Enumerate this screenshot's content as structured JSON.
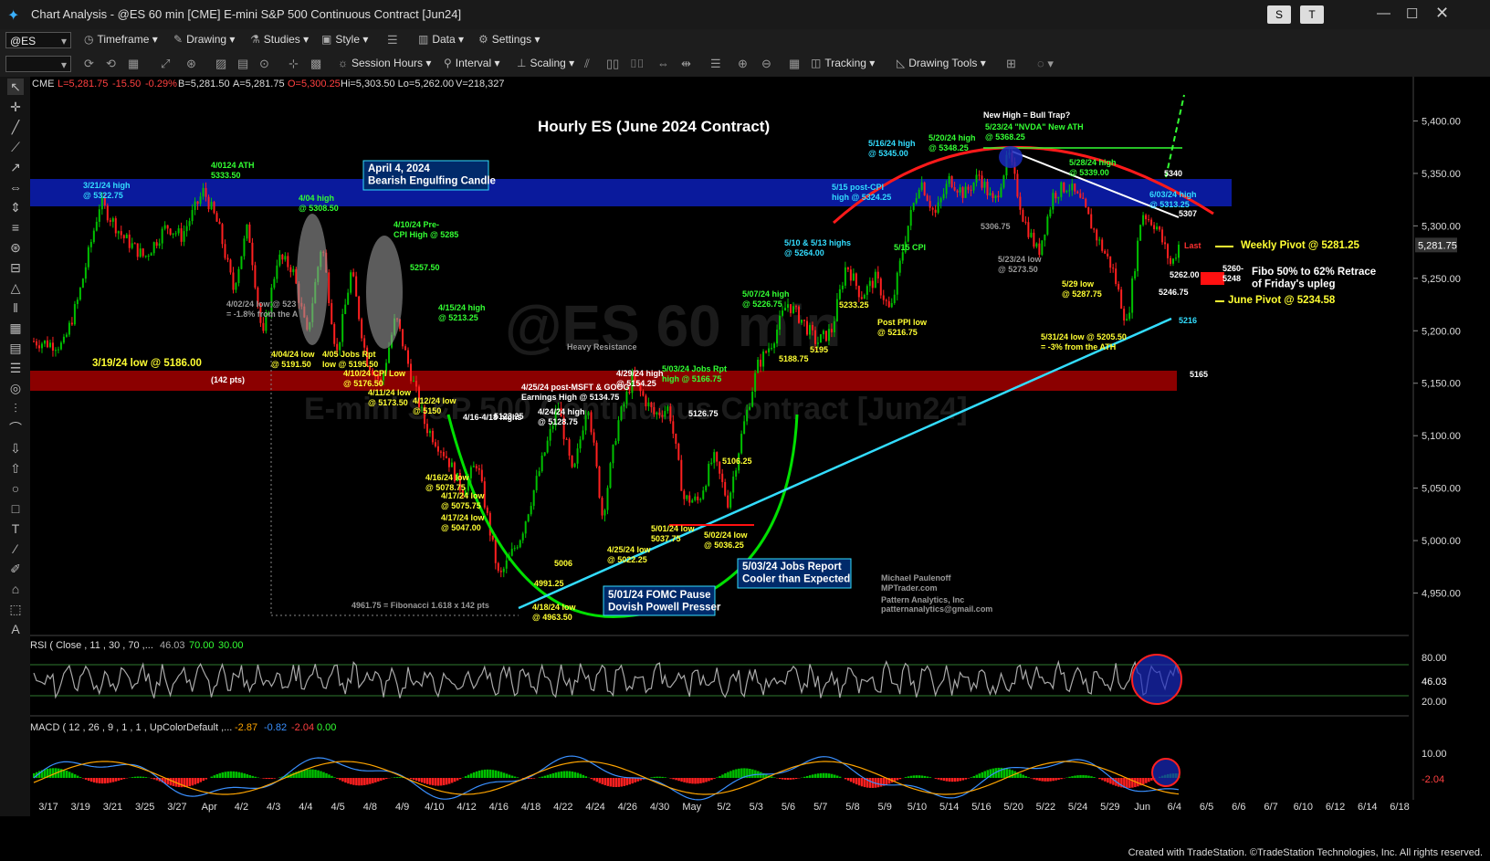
{
  "window": {
    "title": "Chart Analysis - @ES 60 min [CME] E-mini S&P 500 Continuous Contract [Jun24]",
    "btn_s": "S",
    "btn_t": "T"
  },
  "toolbar1": {
    "symbol": "@ES",
    "timeframe": "Timeframe",
    "drawing": "Drawing",
    "studies": "Studies",
    "style": "Style",
    "data": "Data",
    "settings": "Settings"
  },
  "toolbar2": {
    "session_hours": "Session Hours",
    "interval": "Interval",
    "scaling": "Scaling",
    "tracking": "Tracking",
    "drawing_tools": "Drawing Tools"
  },
  "chart_header": {
    "exchange": "CME",
    "last": "L=5,281.75",
    "change": "-15.50",
    "pct": "-0.29%",
    "bid": "B=5,281.50",
    "ask": "A=5,281.75",
    "open": "O=5,300.25",
    "hilo": "Hi=5,303.50  Lo=5,262.00",
    "volume": "V=218,327"
  },
  "colors": {
    "up": "#00c000",
    "down": "#ff2020",
    "band_blue": "#0a1a9c",
    "band_red": "#8b0000",
    "label_yellow": "#ffff33",
    "label_green": "#33ff33",
    "label_cyan": "#33ddff"
  },
  "chart_data": {
    "type": "candlestick",
    "title": "Hourly ES (June 2024 Contract)",
    "watermark_line1": "@ES 60 min",
    "watermark_line2": "E-mini S&P 500 Continuous Contract [Jun24]",
    "ylim": [
      4920,
      5430
    ],
    "y_ticks": [
      "5,400.00",
      "5,350.00",
      "5,300.00",
      "5,250.00",
      "5,200.00",
      "5,150.00",
      "5,100.00",
      "5,050.00",
      "5,000.00",
      "4,950.00"
    ],
    "last_price": "5,281.75",
    "x_ticks": [
      "3/17",
      "3/19",
      "3/21",
      "3/25",
      "3/27",
      "Apr",
      "4/2",
      "4/3",
      "4/4",
      "4/5",
      "4/8",
      "4/9",
      "4/10",
      "4/12",
      "4/16",
      "4/18",
      "4/22",
      "4/24",
      "4/26",
      "4/30",
      "May",
      "5/2",
      "5/3",
      "5/6",
      "5/7",
      "5/8",
      "5/9",
      "5/10",
      "5/14",
      "5/16",
      "5/20",
      "5/22",
      "5/24",
      "5/29",
      "Jun",
      "6/4",
      "6/5",
      "6/6",
      "6/7",
      "6/10",
      "6/12",
      "6/14",
      "6/18"
    ],
    "price_path": [
      [
        0,
        5190
      ],
      [
        0.04,
        5186
      ],
      [
        0.06,
        5230
      ],
      [
        0.09,
        5322.75
      ],
      [
        0.12,
        5290
      ],
      [
        0.15,
        5270
      ],
      [
        0.18,
        5300
      ],
      [
        0.2,
        5290
      ],
      [
        0.23,
        5333.5
      ],
      [
        0.25,
        5300
      ],
      [
        0.27,
        5240
      ],
      [
        0.29,
        5300
      ],
      [
        0.31,
        5191.5
      ],
      [
        0.33,
        5270
      ],
      [
        0.35,
        5260
      ],
      [
        0.37,
        5195.5
      ],
      [
        0.39,
        5285
      ],
      [
        0.41,
        5176.5
      ],
      [
        0.43,
        5257.5
      ],
      [
        0.45,
        5173.5
      ],
      [
        0.47,
        5150
      ],
      [
        0.49,
        5213.25
      ],
      [
        0.51,
        5160
      ],
      [
        0.53,
        5110
      ],
      [
        0.56,
        5078.75
      ],
      [
        0.58,
        5047
      ],
      [
        0.6,
        5075
      ],
      [
        0.62,
        5000
      ],
      [
        0.63,
        4963.5
      ],
      [
        0.66,
        5006
      ],
      [
        0.69,
        5080
      ],
      [
        0.71,
        5128.75
      ],
      [
        0.73,
        5060
      ],
      [
        0.75,
        5134.75
      ],
      [
        0.77,
        5022.25
      ],
      [
        0.79,
        5110
      ],
      [
        0.81,
        5154.25
      ],
      [
        0.84,
        5120
      ],
      [
        0.86,
        5126.75
      ],
      [
        0.88,
        5040
      ],
      [
        0.9,
        5037.75
      ],
      [
        0.92,
        5080
      ],
      [
        0.94,
        5036.25
      ],
      [
        0.96,
        5106.25
      ],
      [
        0.98,
        5166.75
      ],
      [
        1.0,
        5190
      ],
      [
        1.02,
        5226.75
      ],
      [
        1.04,
        5210
      ],
      [
        1.06,
        5188.75
      ],
      [
        1.08,
        5200
      ],
      [
        1.1,
        5264
      ],
      [
        1.12,
        5233.25
      ],
      [
        1.14,
        5250
      ],
      [
        1.16,
        5216.75
      ],
      [
        1.18,
        5290
      ],
      [
        1.2,
        5345
      ],
      [
        1.22,
        5310
      ],
      [
        1.24,
        5345
      ],
      [
        1.26,
        5330
      ],
      [
        1.28,
        5348.25
      ],
      [
        1.3,
        5320
      ],
      [
        1.32,
        5368.25
      ],
      [
        1.34,
        5306.75
      ],
      [
        1.36,
        5273.5
      ],
      [
        1.38,
        5330
      ],
      [
        1.4,
        5339
      ],
      [
        1.42,
        5320
      ],
      [
        1.44,
        5287.75
      ],
      [
        1.46,
        5260
      ],
      [
        1.48,
        5205.5
      ],
      [
        1.5,
        5313.25
      ],
      [
        1.52,
        5300
      ],
      [
        1.54,
        5262
      ],
      [
        1.55,
        5281.75
      ]
    ],
    "rsi": {
      "label": "RSI ( Close , 11 , 30 , 70 ,...",
      "value": "46.03",
      "upper": "70.00",
      "lower": "30.00",
      "ticks": [
        "80.00",
        "46.03",
        "20.00"
      ]
    },
    "macd": {
      "label": "MACD ( 12 , 26 , 9 , 1 , 1 , UpColorDefault ,...",
      "v1": "-2.87",
      "v2": "-0.82",
      "v3": "-2.04",
      "v4": "0.00",
      "ticks": [
        "10.00",
        "-2.04"
      ]
    }
  },
  "annotations": [
    {
      "text": "3/21/24 high",
      "sub": "@ 5322.75",
      "color": "cyan"
    },
    {
      "text": "4/0124 ATH",
      "sub": "5333.50",
      "color": "green"
    },
    {
      "text": "April 4, 2024",
      "sub": "Bearish Engulfing Candle",
      "color": "box"
    },
    {
      "text": "4/04 high",
      "sub": "@ 5308.50",
      "color": "green"
    },
    {
      "text": "4/10/24 Pre-",
      "sub": "CPI High @ 5285",
      "color": "green"
    },
    {
      "text": "5257.50",
      "color": "green"
    },
    {
      "text": "4/15/24 high",
      "sub": "@ 5213.25",
      "color": "green"
    },
    {
      "text": "3/19/24 low @ 5186.00",
      "color": "yellow"
    },
    {
      "text": "(142 pts)",
      "color": "white"
    },
    {
      "text": "4/02/24 low @ 523",
      "sub": "= -1.8% from the A",
      "color": "grey"
    },
    {
      "text": "4/04/24 low",
      "sub": "@ 5191.50",
      "color": "yellow"
    },
    {
      "text": "4/05 Jobs Rpt",
      "sub": "low @ 5195.50",
      "color": "yellow"
    },
    {
      "text": "4/10/24 CPI Low",
      "sub": "@ 5176.50",
      "color": "yellow"
    },
    {
      "text": "4/11/24 low",
      "sub": "@ 5173.50",
      "color": "yellow"
    },
    {
      "text": "4/12/24 low",
      "sub": "@ 5150",
      "color": "yellow"
    },
    {
      "text": "4/16-4/18 highs",
      "color": "white"
    },
    {
      "text": "5123.25",
      "color": "white"
    },
    {
      "text": "4/16/24 low",
      "sub": "@ 5078.75",
      "color": "yellow"
    },
    {
      "text": "4/17/24 low",
      "sub": "@ 5075.75",
      "color": "yellow"
    },
    {
      "text": "4/17/24 low",
      "sub": "@ 5047.00",
      "color": "yellow"
    },
    {
      "text": "4991.25",
      "color": "yellow"
    },
    {
      "text": "5006",
      "color": "yellow"
    },
    {
      "text": "4/18/24 low",
      "sub": "@ 4963.50",
      "color": "yellow"
    },
    {
      "text": "4961.75 = Fibonacci 1.618 x 142 pts",
      "color": "grey"
    },
    {
      "text": "4/25/24 post-MSFT & GOOG",
      "sub": "Earnings High @ 5134.75",
      "color": "white"
    },
    {
      "text": "4/24/24 high",
      "sub": "@ 5128.75",
      "color": "white"
    },
    {
      "text": "4/29/24 high",
      "sub": "@ 5154.25",
      "color": "white"
    },
    {
      "text": "5/03/24 Jobs Rpt",
      "sub": "high @ 5166.75",
      "color": "green"
    },
    {
      "text": "5126.75",
      "color": "white"
    },
    {
      "text": "4/25/24 low",
      "sub": "@ 5022.25",
      "color": "yellow"
    },
    {
      "text": "5/01/24 low",
      "sub": "5037.75",
      "color": "yellow"
    },
    {
      "text": "5/02/24 low",
      "sub": "@ 5036.25",
      "color": "yellow"
    },
    {
      "text": "5106.25",
      "color": "yellow"
    },
    {
      "text": "5/01/24 FOMC Pause",
      "sub": "Dovish Powell Presser",
      "color": "box"
    },
    {
      "text": "5/03/24 Jobs Report",
      "sub": "Cooler than Expected",
      "color": "box"
    },
    {
      "text": "5/07/24 high",
      "sub": "@ 5226.75",
      "color": "green"
    },
    {
      "text": "5188.75",
      "color": "yellow"
    },
    {
      "text": "5195",
      "color": "yellow"
    },
    {
      "text": "5/10 & 5/13 highs",
      "sub": "@ 5264.00",
      "color": "cyan"
    },
    {
      "text": "5233.25",
      "color": "yellow"
    },
    {
      "text": "Post PPI low",
      "sub": "@ 5216.75",
      "color": "yellow"
    },
    {
      "text": "5/15 CPI",
      "color": "green"
    },
    {
      "text": "5/15 post-CPI",
      "sub": "high @ 5324.25",
      "color": "cyan"
    },
    {
      "text": "5/16/24 high",
      "sub": "@ 5345.00",
      "color": "cyan"
    },
    {
      "text": "5/20/24 high",
      "sub": "@ 5348.25",
      "color": "green"
    },
    {
      "text": "New High = Bull Trap?",
      "color": "white"
    },
    {
      "text": "5/23/24 \"NVDA\" New ATH",
      "sub": "@ 5368.25",
      "color": "green"
    },
    {
      "text": "5306.75",
      "color": "grey"
    },
    {
      "text": "5/23/24 low",
      "sub": "@ 5273.50",
      "color": "grey"
    },
    {
      "text": "5/28/24 high",
      "sub": "@ 5339.00",
      "color": "green"
    },
    {
      "text": "5/29 low",
      "sub": "@ 5287.75",
      "color": "yellow"
    },
    {
      "text": "5/31/24 low @ 5205.50",
      "sub": "= -3% from the ATH",
      "color": "yellow"
    },
    {
      "text": "6/03/24 high",
      "sub": "@ 5313.25",
      "color": "cyan"
    },
    {
      "text": "5340",
      "color": "white"
    },
    {
      "text": "5307",
      "color": "white"
    },
    {
      "text": "5262.00",
      "color": "white"
    },
    {
      "text": "5246.75",
      "color": "white"
    },
    {
      "text": "5216",
      "color": "cyan"
    },
    {
      "text": "5165",
      "color": "white"
    },
    {
      "text": "Weekly Pivot @ 5281.25",
      "color": "yellow"
    },
    {
      "text": "June Pivot @ 5234.58",
      "color": "yellow"
    },
    {
      "text": "Fibo 50% to 62% Retrace",
      "sub": "of Friday's upleg",
      "color": "white"
    },
    {
      "text": "5260-",
      "sub": "5248",
      "color": "white"
    },
    {
      "text": "Last",
      "color": "red"
    },
    {
      "text": "Heavy Resistance",
      "color": "grey"
    },
    {
      "text": "Michael Paulenoff",
      "sub": "MPTrader.com",
      "color": "grey"
    }
  ],
  "signature": {
    "line3": "Pattern Analytics, Inc",
    "line4": "patternanalytics@gmail.com"
  },
  "footer": {
    "credit": "Created with TradeStation. ©TradeStation Technologies, Inc. All rights reserved."
  }
}
